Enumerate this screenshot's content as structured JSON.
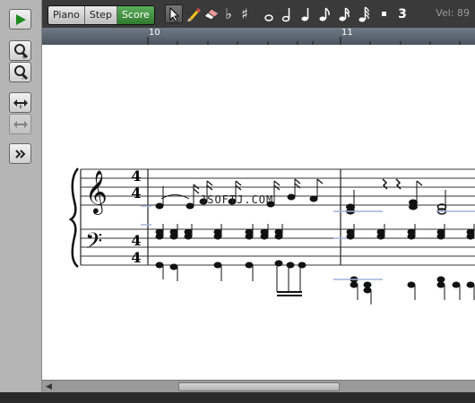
{
  "toolbar": {
    "tabs": [
      {
        "label": "Piano",
        "active": false
      },
      {
        "label": "Step",
        "active": false
      },
      {
        "label": "Score",
        "active": true
      }
    ],
    "tuplet_label": "3",
    "velocity": "Vel: 89",
    "icons": [
      "play-icon",
      "zoom-in-icon",
      "zoom-out-icon",
      "expand-horizontal-icon",
      "shrink-horizontal-icon",
      "more-icon",
      "select-arrow-icon",
      "pencil-icon",
      "eraser-icon",
      "flat-icon",
      "sharp-icon",
      "whole-note-icon",
      "half-note-icon",
      "quarter-note-icon",
      "eighth-note-icon",
      "sixteenth-note-icon",
      "thirtysecond-note-icon",
      "dot-icon"
    ]
  },
  "ruler": {
    "measures": [
      "10",
      "11"
    ]
  },
  "score": {
    "watermark": "JSOFTJ.COM",
    "time_signature_treble": [
      "4",
      "4"
    ],
    "time_signature_bass": [
      "4",
      "4"
    ]
  },
  "colors": {
    "accent_active_tab": "#3e8f3e",
    "toolbar_bg": "#3a3a3a",
    "ruler_bg": "#5b6570"
  }
}
